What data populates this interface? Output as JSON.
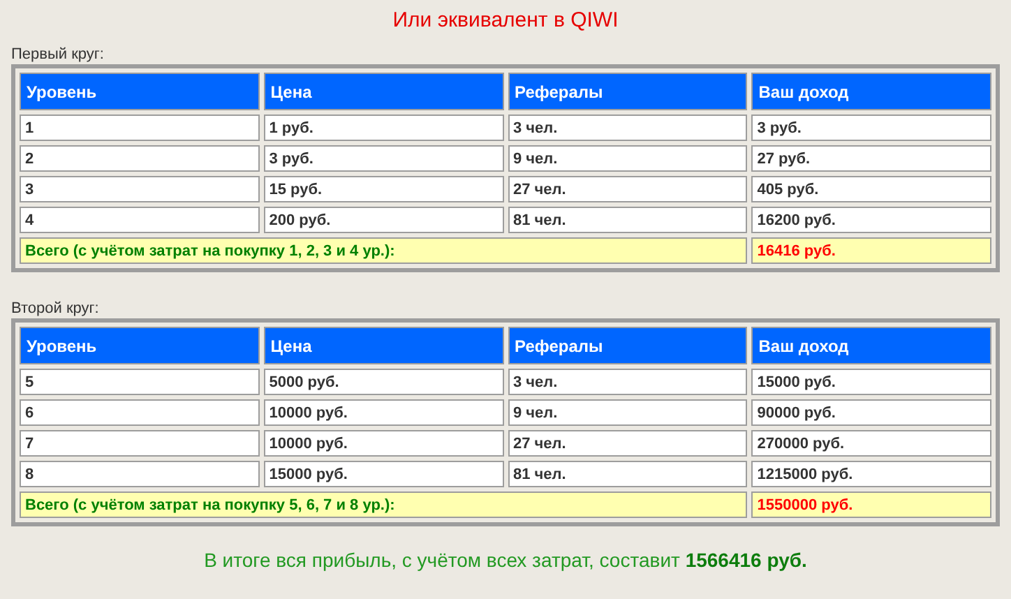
{
  "title": "Или эквивалент в QIWI",
  "sections": [
    {
      "label": "Первый круг:",
      "columns": [
        "Уровень",
        "Цена",
        "Рефералы",
        "Ваш доход"
      ],
      "rows": [
        [
          "1",
          "1 руб.",
          "3 чел.",
          "3 руб."
        ],
        [
          "2",
          "3 руб.",
          "9 чел.",
          "27 руб."
        ],
        [
          "3",
          "15 руб.",
          "27 чел.",
          "405 руб."
        ],
        [
          "4",
          "200 руб.",
          "81 чел.",
          "16200 руб."
        ]
      ],
      "total": {
        "label": "Всего (с учётом затрат на покупку 1, 2, 3 и 4 ур.):",
        "value": "16416 руб."
      }
    },
    {
      "label": "Второй круг:",
      "columns": [
        "Уровень",
        "Цена",
        "Рефералы",
        "Ваш доход"
      ],
      "rows": [
        [
          "5",
          "5000 руб.",
          "3 чел.",
          "15000 руб."
        ],
        [
          "6",
          "10000 руб.",
          "9 чел.",
          "90000 руб."
        ],
        [
          "7",
          "10000 руб.",
          "27 чел.",
          "270000 руб."
        ],
        [
          "8",
          "15000 руб.",
          "81 чел.",
          "1215000 руб."
        ]
      ],
      "total": {
        "label": "Всего (с учётом затрат на покупку 5, 6, 7 и 8 ур.):",
        "value": "1550000 руб."
      }
    }
  ],
  "summary": "В итоге вся прибыль, с учётом всех затрат, составит **1566416 руб.**"
}
